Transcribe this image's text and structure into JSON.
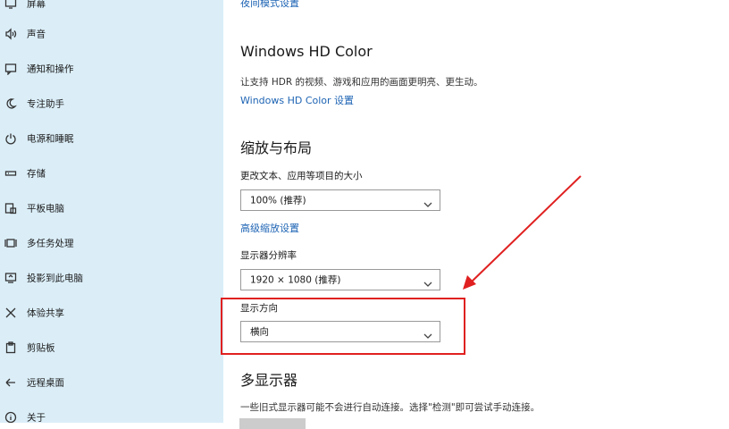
{
  "sidebar": {
    "items": [
      {
        "icon": "display-icon",
        "label": "屏幕"
      },
      {
        "icon": "speaker-icon",
        "label": "声音"
      },
      {
        "icon": "notification-icon",
        "label": "通知和操作"
      },
      {
        "icon": "moon-icon",
        "label": "专注助手"
      },
      {
        "icon": "power-icon",
        "label": "电源和睡眠"
      },
      {
        "icon": "storage-icon",
        "label": "存储"
      },
      {
        "icon": "tablet-icon",
        "label": "平板电脑"
      },
      {
        "icon": "multitask-icon",
        "label": "多任务处理"
      },
      {
        "icon": "project-icon",
        "label": "投影到此电脑"
      },
      {
        "icon": "share-icon",
        "label": "体验共享"
      },
      {
        "icon": "clipboard-icon",
        "label": "剪贴板"
      },
      {
        "icon": "remote-desktop-icon",
        "label": "远程桌面"
      },
      {
        "icon": "info-icon",
        "label": "关于"
      }
    ]
  },
  "main": {
    "night_mode_link": "夜间模式设置",
    "hd_color": {
      "title": "Windows HD Color",
      "description": "让支持 HDR 的视频、游戏和应用的画面更明亮、更生动。",
      "link": "Windows HD Color 设置"
    },
    "scale_layout": {
      "title": "缩放与布局",
      "text_size_label": "更改文本、应用等项目的大小",
      "text_size_value": "100% (推荐)",
      "advanced_link": "高级缩放设置",
      "resolution_label": "显示器分辨率",
      "resolution_value": "1920 × 1080 (推荐)",
      "orientation_label": "显示方向",
      "orientation_value": "横向"
    },
    "multi_display": {
      "title": "多显示器",
      "description": "一些旧式显示器可能不会进行自动连接。选择\"检测\"即可尝试手动连接。"
    }
  },
  "annotation_color": "#e02020",
  "sidebar_color": "#dbeef8",
  "link_color": "#1e64b4"
}
